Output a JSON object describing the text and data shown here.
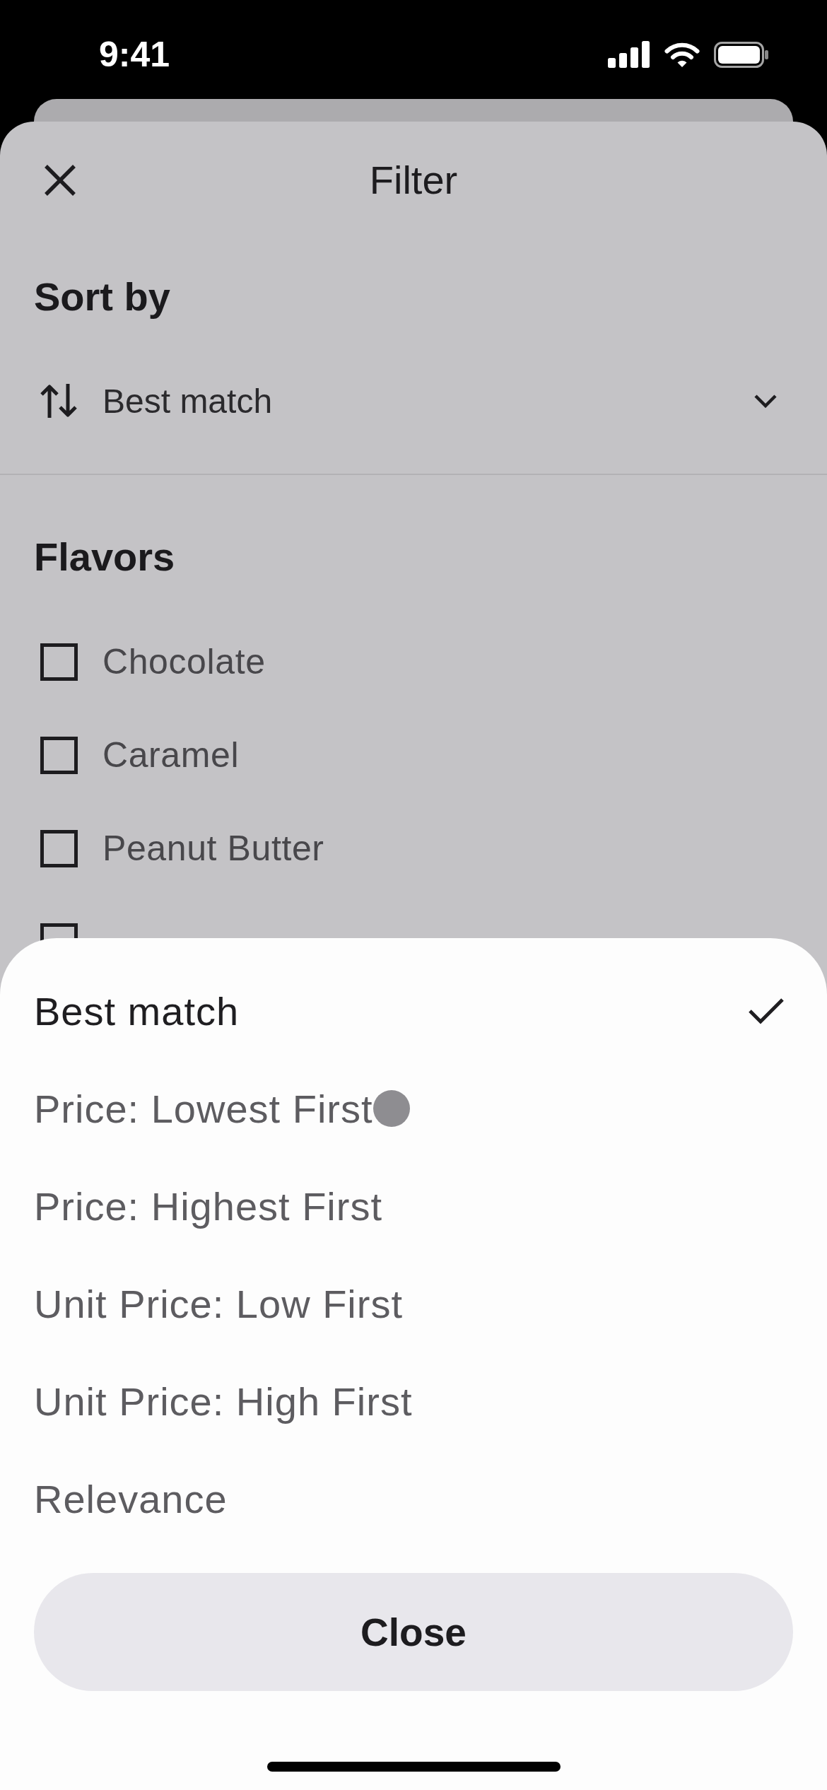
{
  "status_bar": {
    "time": "9:41"
  },
  "filter_panel": {
    "title": "Filter",
    "sort": {
      "heading": "Sort by",
      "value": "Best match"
    },
    "flavors": {
      "heading": "Flavors",
      "items": [
        {
          "label": "Chocolate",
          "checked": false
        },
        {
          "label": "Caramel",
          "checked": false
        },
        {
          "label": "Peanut Butter",
          "checked": false
        },
        {
          "checked": false
        }
      ]
    }
  },
  "sort_sheet": {
    "options": [
      {
        "label": "Best match",
        "selected": true,
        "touched": false
      },
      {
        "label": "Price: Lowest First",
        "selected": false,
        "touched": true
      },
      {
        "label": "Price: Highest First",
        "selected": false,
        "touched": false
      },
      {
        "label": "Unit Price: Low First",
        "selected": false,
        "touched": false
      },
      {
        "label": "Unit Price: High First",
        "selected": false,
        "touched": false
      },
      {
        "label": "Relevance",
        "selected": false,
        "touched": false
      }
    ],
    "close_button": "Close"
  }
}
